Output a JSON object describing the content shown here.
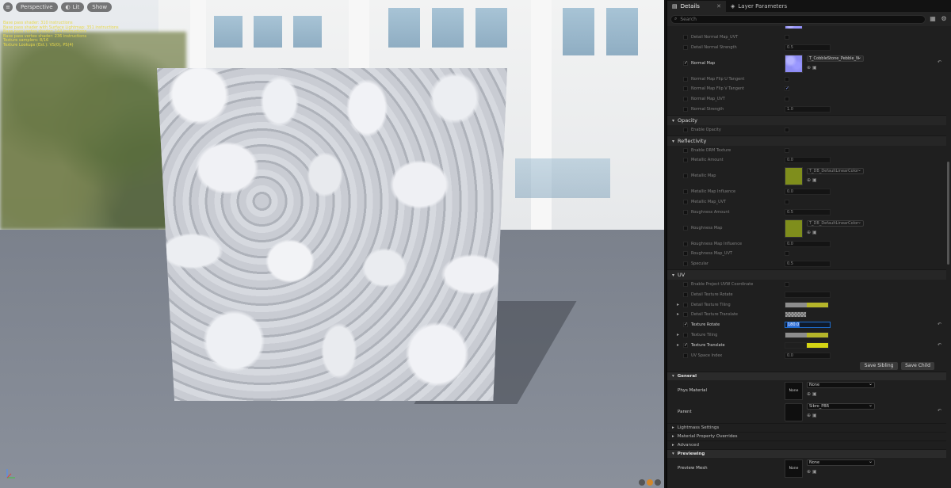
{
  "viewport": {
    "buttons": {
      "perspective": "Perspective",
      "lit": "Lit",
      "show": "Show"
    },
    "stats": [
      "Base pass shader: 310 instructions",
      "Base pass shader with Surface Lightmap: 351 instructions",
      "Base pass vertex shader: 144 instructions",
      "Base pass vertex shader: 236 instructions",
      "Texture samplers: 8/16",
      "Texture Lookups (Est.): VS(0), PS(4)"
    ],
    "colors": {
      "stats_text": "#e7d84a"
    }
  },
  "tabs": {
    "details": "Details",
    "layer_parameters": "Layer Parameters"
  },
  "search": {
    "placeholder": "Search"
  },
  "rows_normal": [
    {
      "label": "Detail Normal Map_UVT",
      "checked": false,
      "value_type": "bool"
    },
    {
      "label": "Detail Normal Strength",
      "checked": false,
      "value": "0.5"
    }
  ],
  "normal_map": {
    "label": "Normal Map",
    "checked": true,
    "texture": "T_CobbleStone_Pebble_N"
  },
  "rows_normal2": [
    {
      "label": "Normal Map Flip U Tangent",
      "checked": false,
      "bool": false
    },
    {
      "label": "Normal Map Flip V Tangent",
      "checked": false,
      "bool": true
    },
    {
      "label": "Normal Map_UVT",
      "checked": false,
      "bool": false
    },
    {
      "label": "Normal Strength",
      "checked": false,
      "value": "1.0"
    }
  ],
  "sections": {
    "opacity": "Opacity",
    "reflectivity": "Reflectivity",
    "uv": "UV"
  },
  "opacity_rows": [
    {
      "label": "Enable Opacity"
    }
  ],
  "reflectivity_rows": {
    "enable_orm": "Enable ORM Texture",
    "metallic_amount": {
      "label": "Metallic Amount",
      "value": "0.0"
    },
    "metallic_map": {
      "label": "Metallic Map",
      "texture": "T_DB_DefaultLinearColor"
    },
    "metallic_influence": {
      "label": "Metallic Map Influence",
      "value": "0.0"
    },
    "metallic_uvt": "Metallic Map_UVT",
    "roughness_amount": {
      "label": "Roughness Amount",
      "value": "0.5"
    },
    "roughness_map": {
      "label": "Roughness Map",
      "texture": "T_DB_DefaultLinearColor"
    },
    "roughness_influence": {
      "label": "Roughness Map Influence",
      "value": "0.0"
    },
    "roughness_uvt": "Roughness Map_UVT",
    "specular": {
      "label": "Specular",
      "value": "0.5"
    }
  },
  "uv_rows": {
    "enable_project": "Enable Project UVW Coordinate",
    "detail_rotate": "Detail Texture Rotate",
    "detail_tiling": "Detail Texture Tiling",
    "detail_translate": "Detail Texture Translate",
    "texture_rotate": {
      "label": "Texture Rotate",
      "value": "180.0"
    },
    "texture_tiling": "Texture Tiling",
    "texture_translate": "Texture Translate",
    "uv_space_index": {
      "label": "UV Space Index",
      "value": "0.0"
    }
  },
  "buttons": {
    "save_sibling": "Save Sibling",
    "save_child": "Save Child"
  },
  "general": {
    "title": "General",
    "phys_material": {
      "label": "Phys Material",
      "value": "None",
      "thumb": "None"
    },
    "parent": {
      "label": "Parent",
      "value": "Sibro_PBR"
    }
  },
  "collapsed_cats": [
    "Lightmass Settings",
    "Material Property Overrides",
    "Advanced"
  ],
  "previewing": {
    "title": "Previewing",
    "preview_mesh": {
      "label": "Preview Mesh",
      "value": "None",
      "thumb": "None"
    }
  },
  "colors": {
    "accent_edit": "#2f6ed6",
    "swatch_yellow": "#b5b52a",
    "swatch_yellow_bright": "#d4d414",
    "olive": "#7f8e1c",
    "normal_blue": "#8e8cf4"
  }
}
